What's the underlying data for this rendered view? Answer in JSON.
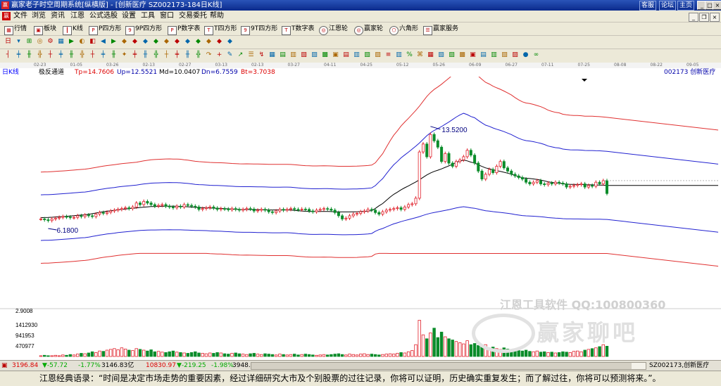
{
  "window": {
    "title": "赢家老子时空周期系统[纵横版] - [创新医疗  SZ002173-184日K线]",
    "links": [
      "客服",
      "论坛",
      "主页"
    ]
  },
  "menu": [
    "文件",
    "浏览",
    "资讯",
    "江恩",
    "公式选股",
    "设置",
    "工具",
    "窗口",
    "交易委托",
    "帮助"
  ],
  "toolbar1": [
    {
      "icon": "grid",
      "label": "行情"
    },
    {
      "icon": "blocks",
      "label": "板块"
    },
    {
      "icon": "kline",
      "label": "K线"
    },
    {
      "icon": "P",
      "label": "P四方形"
    },
    {
      "icon": "9P",
      "label": "9P四方形"
    },
    {
      "icon": "P",
      "label": "P数字表"
    },
    {
      "icon": "T",
      "label": "T四方形"
    },
    {
      "icon": "9T",
      "label": "9T四方形"
    },
    {
      "icon": "T",
      "label": "T数字表"
    },
    {
      "icon": "wheel",
      "label": "江恩轮"
    },
    {
      "icon": "wheel",
      "label": "赢家轮"
    },
    {
      "icon": "hex",
      "label": "六角形"
    },
    {
      "icon": "service",
      "label": "赢家服务"
    }
  ],
  "toolbar2_glyphs": [
    "日",
    "▾",
    "⊞",
    "◎",
    "⚙",
    "▦",
    "▶",
    "◐",
    "◧",
    "◀",
    "▶",
    "◆",
    "◆",
    "◆",
    "◆",
    "◆",
    "◆",
    "◆",
    "◆",
    "◆",
    "◆",
    "◆"
  ],
  "toolbar3_glyphs": [
    "┤",
    "╪",
    "╫",
    "╬",
    "┼",
    "╪",
    "╫",
    "╬",
    "┼",
    "╪",
    "╫",
    "✦",
    "╪",
    "╫",
    "╬",
    "┼",
    "╪",
    "╫",
    "╬",
    "↷",
    "+",
    "✎",
    "↗",
    "☰",
    "↯",
    "▦",
    "▤",
    "▥",
    "▧",
    "▨",
    "▩",
    "▣",
    "▤",
    "▥",
    "▧",
    "▨",
    "≡",
    "▥",
    "%",
    "⌘",
    "▦",
    "▧",
    "▨",
    "▩",
    "▣",
    "▤",
    "▥",
    "▧",
    "▨",
    "●",
    "∞"
  ],
  "date_labels": [
    "02-23",
    "01-05",
    "03-26",
    "02-13",
    "02-27",
    "03-13",
    "02-13",
    "03-27",
    "04-11",
    "04-25",
    "05-12",
    "05-26",
    "06-09",
    "06-27",
    "07-11",
    "07-25",
    "08-08",
    "08-22",
    "09-05",
    "09-19"
  ],
  "indicator": {
    "period": "日K线",
    "name": "极反通道",
    "tp": "Tp=14.7606",
    "up": "Up=12.5521",
    "md": "Md=10.0407",
    "dn": "Dn=6.7559",
    "bt": "Bt=3.7038",
    "stock": "002173  创新医疗"
  },
  "chart_data": {
    "type": "candlestick",
    "high_label": "13.5200",
    "low_label": "6.1800",
    "volume_ticks": [
      "2.9008",
      "1412930",
      "941953",
      "470977"
    ],
    "colors": {
      "up": "#e0202a",
      "down": "#0a8c2a",
      "bands_outer": "#e03030",
      "bands_inner": "#2020d0",
      "mid": "#000000"
    },
    "volume_max": 1600000,
    "price_range": [
      3.0,
      16.0
    ],
    "closes": [
      7.3,
      7.25,
      7.2,
      7.3,
      7.35,
      7.4,
      7.45,
      7.42,
      7.38,
      7.4,
      7.5,
      7.45,
      7.55,
      7.5,
      7.45,
      7.6,
      7.7,
      7.65,
      7.72,
      7.8,
      7.85,
      7.9,
      7.95,
      8.0,
      7.95,
      8.05,
      8.3,
      8.2,
      8.4,
      8.3,
      8.2,
      8.1,
      8.15,
      8.2,
      8.1,
      8.05,
      8.0,
      8.1,
      8.05,
      8.2,
      8.15,
      8.1,
      8.05,
      7.9,
      7.95,
      8.0,
      8.05,
      7.98,
      7.9,
      7.95,
      7.92,
      7.88,
      7.95,
      7.9,
      7.85,
      7.9,
      7.95,
      7.92,
      7.8,
      7.85,
      7.9,
      7.85,
      7.75,
      7.7,
      7.8,
      7.9,
      7.85,
      7.9,
      7.95,
      7.9,
      7.88,
      7.92,
      7.9,
      7.8,
      7.75,
      7.85,
      7.9,
      7.95,
      7.92,
      7.85,
      7.7,
      7.5,
      7.3,
      7.35,
      7.5,
      7.6,
      7.65,
      7.75,
      7.8,
      7.9,
      7.85,
      7.7,
      7.6,
      7.75,
      7.85,
      7.9,
      7.95,
      8.0,
      7.9,
      8.05,
      8.2,
      8.25,
      8.6,
      11.5,
      12.0,
      11.2,
      12.6,
      12.2,
      11.8,
      10.9,
      11.4,
      10.8,
      10.6,
      10.9,
      11.0,
      11.2,
      11.6,
      11.3,
      10.8,
      10.3,
      9.8,
      10.1,
      10.4,
      10.2,
      10.6,
      10.9,
      10.5,
      10.3,
      10.1,
      10.0,
      9.9,
      9.8,
      9.6,
      9.5,
      9.6,
      9.7,
      9.5,
      9.45,
      9.55,
      9.5,
      9.6,
      9.55,
      9.5,
      9.3,
      9.35,
      9.4,
      9.45,
      9.5,
      9.3,
      9.4,
      9.35,
      9.6,
      9.5,
      9.7,
      8.9
    ],
    "volumes": [
      0.02,
      0.03,
      0.02,
      0.02,
      0.03,
      0.02,
      0.04,
      0.03,
      0.05,
      0.04,
      0.06,
      0.08,
      0.07,
      0.09,
      0.12,
      0.1,
      0.14,
      0.13,
      0.16,
      0.18,
      0.2,
      0.17,
      0.22,
      0.19,
      0.16,
      0.15,
      0.2,
      0.18,
      0.16,
      0.14,
      0.17,
      0.12,
      0.13,
      0.11,
      0.1,
      0.12,
      0.14,
      0.11,
      0.1,
      0.09,
      0.08,
      0.1,
      0.12,
      0.09,
      0.08,
      0.07,
      0.09,
      0.08,
      0.1,
      0.09,
      0.07,
      0.06,
      0.08,
      0.09,
      0.07,
      0.06,
      0.05,
      0.07,
      0.08,
      0.06,
      0.05,
      0.07,
      0.06,
      0.05,
      0.04,
      0.06,
      0.05,
      0.04,
      0.05,
      0.06,
      0.04,
      0.05,
      0.06,
      0.05,
      0.04,
      0.03,
      0.04,
      0.05,
      0.04,
      0.05,
      0.06,
      0.07,
      0.05,
      0.04,
      0.06,
      0.05,
      0.04,
      0.06,
      0.07,
      0.05,
      0.06,
      0.05,
      0.04,
      0.05,
      0.06,
      0.07,
      0.06,
      0.08,
      0.1,
      0.09,
      0.12,
      0.15,
      0.3,
      0.92,
      0.55,
      0.45,
      0.6,
      0.72,
      0.48,
      0.62,
      0.5,
      0.45,
      0.42,
      0.38,
      0.35,
      0.32,
      0.4,
      0.3,
      0.33,
      0.28,
      0.25,
      0.3,
      0.22,
      0.24,
      0.2,
      0.18,
      0.22,
      0.19,
      0.16,
      0.18,
      0.15,
      0.14,
      0.16,
      0.13,
      0.12,
      0.14,
      0.11,
      0.12,
      0.1,
      0.11,
      0.09,
      0.1,
      0.12,
      0.11,
      0.1,
      0.13,
      0.14,
      0.12,
      0.16,
      0.18,
      0.2,
      0.22,
      0.25,
      0.3,
      0.26
    ]
  },
  "indices": {
    "sh_value": "3196.84",
    "sh_change": "▼-57.72",
    "sh_pct": "-1.77%",
    "sh_amount": "3146.83亿",
    "sz_value": "10830.97",
    "sz_change": "▼-219.25",
    "sz_pct": "-1.98%",
    "sz_amount": "3948.",
    "stock": "SZ002173,创新医疗"
  },
  "watermark": {
    "line1": "江恩工具软件  QQ:100800360",
    "line2": "赢家聊吧",
    "logo": "赢家"
  },
  "status": {
    "quote": "江恩经典语录：“时间是决定市场走势的重要因素，经过详细研究大市及个别股票的过往记录，你将可以证明，历史确实重复发生；而了解过往，你将可以预测将来。”。"
  }
}
